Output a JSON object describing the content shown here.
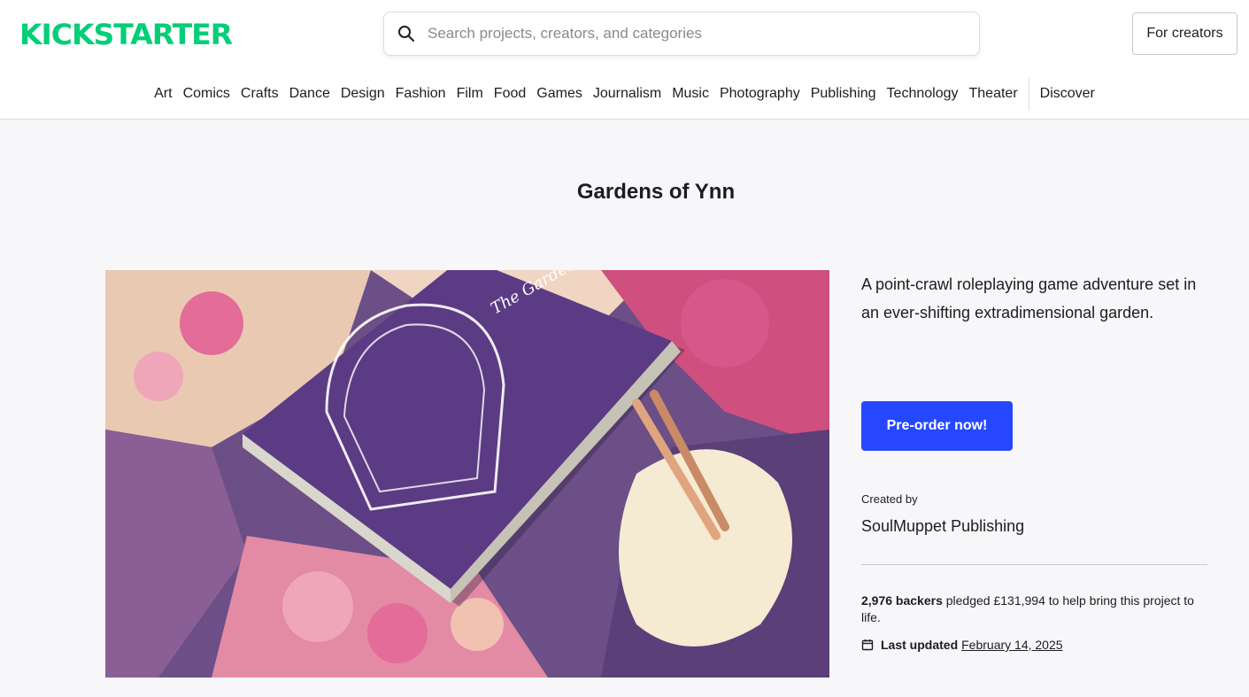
{
  "brand": {
    "name": "KICKSTARTER",
    "color": "#05ce78"
  },
  "search": {
    "placeholder": "Search projects, creators, and categories"
  },
  "header": {
    "creators_button": "For creators"
  },
  "categories": [
    "Art",
    "Comics",
    "Crafts",
    "Dance",
    "Design",
    "Fashion",
    "Film",
    "Food",
    "Games",
    "Journalism",
    "Music",
    "Photography",
    "Publishing",
    "Technology",
    "Theater"
  ],
  "nav": {
    "discover": "Discover"
  },
  "project": {
    "title": "Gardens of Ynn",
    "blurb": "A point-crawl roleplaying game adventure set in an ever-shifting extradimensional garden.",
    "cta": "Pre-order now!",
    "created_by_label": "Created by",
    "creator": "SoulMuppet Publishing",
    "backers_count": "2,976 backers",
    "pledge_text": "pledged £131,994 to help bring this project to life.",
    "last_updated_label": "Last updated",
    "last_updated_date": "February 14, 2025"
  },
  "hero_image": {
    "book_cover_text": "The Gardens of Ynn"
  },
  "colors": {
    "accent": "#2548ff",
    "brand": "#05ce78"
  }
}
